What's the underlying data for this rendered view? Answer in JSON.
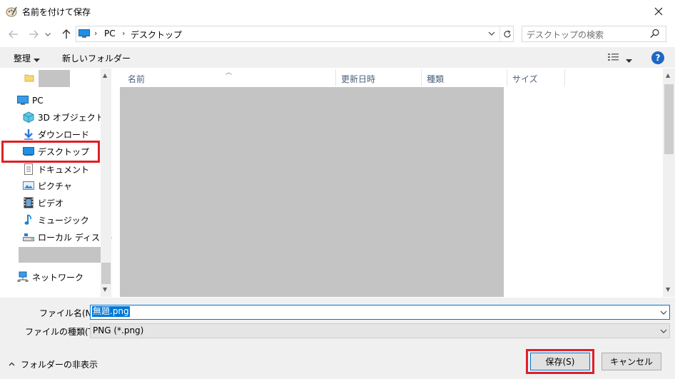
{
  "window": {
    "title": "名前を付けて保存"
  },
  "address": {
    "root": "PC",
    "current": "デスクトップ"
  },
  "search": {
    "placeholder": "デスクトップの検索"
  },
  "toolbar": {
    "organize": "整理",
    "new_folder": "新しいフォルダー",
    "help": "?"
  },
  "nav": {
    "items": [
      {
        "label": "PC"
      },
      {
        "label": "3D オブジェクト"
      },
      {
        "label": "ダウンロード"
      },
      {
        "label": "デスクトップ"
      },
      {
        "label": "ドキュメント"
      },
      {
        "label": "ピクチャ"
      },
      {
        "label": "ビデオ"
      },
      {
        "label": "ミュージック"
      },
      {
        "label": "ローカル ディスク (C"
      },
      {
        "label": "ネットワーク"
      }
    ],
    "selected": "デスクトップ"
  },
  "columns": {
    "name": "名前",
    "date": "更新日時",
    "type": "種類",
    "size": "サイズ"
  },
  "form": {
    "filename_label": "ファイル名(N):",
    "filename_value": "無題.png",
    "filetype_label": "ファイルの種類(T):",
    "filetype_value": "PNG (*.png)"
  },
  "footer": {
    "hide_folders": "フォルダーの非表示",
    "save": "保存(S)",
    "cancel": "キャンセル"
  },
  "colors": {
    "highlight": "#e01f26",
    "accent": "#0078d7"
  }
}
